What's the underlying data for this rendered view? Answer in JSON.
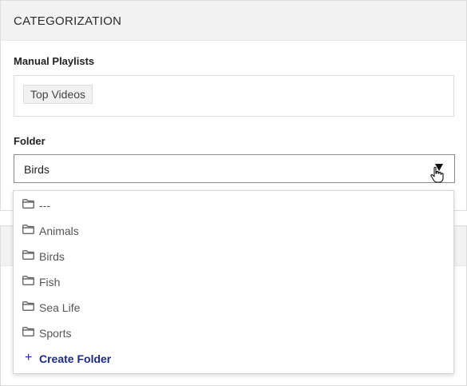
{
  "section": {
    "title": "CATEGORIZATION"
  },
  "playlists": {
    "label": "Manual Playlists",
    "tags": [
      "Top Videos"
    ]
  },
  "folder": {
    "label": "Folder",
    "selected": "Birds",
    "options": [
      "---",
      "Animals",
      "Birds",
      "Fish",
      "Sea Life",
      "Sports"
    ],
    "create_label": "Create Folder",
    "create_icon": "+"
  },
  "colors": {
    "accent": "#1a2a8a",
    "header_bg": "#f2f2f2"
  }
}
